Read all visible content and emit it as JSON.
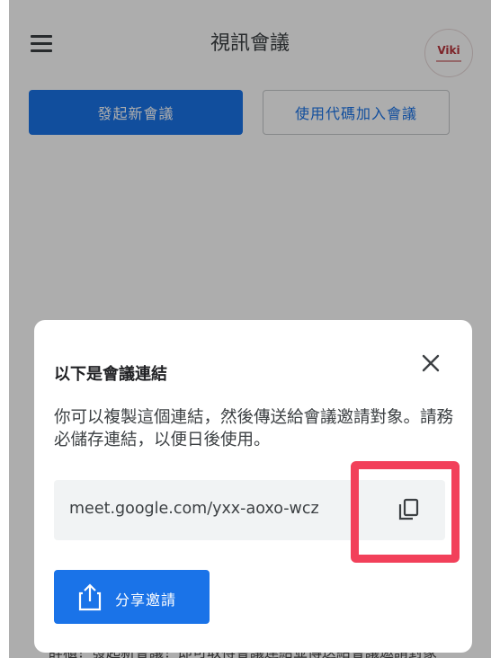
{
  "appbar": {
    "title": "視訊會議",
    "menu_icon": "hamburger-menu-icon",
    "avatar_text": "Viki"
  },
  "actions": {
    "new_meeting": "發起新會議",
    "join_with_code": "使用代碼加入會議"
  },
  "background_text": "辞櫃！發起新會議！即可取得會議連結並傳送給會議邀請對象",
  "dialog": {
    "title": "以下是會議連結",
    "body": "你可以複製這個連結，然後傳送給會議邀請對象。請務必儲存連結，以便日後使用。",
    "link": "meet.google.com/yxx-aoxo-wcz",
    "copy_icon": "copy-icon",
    "close_icon": "close-icon",
    "share_label": "分享邀請",
    "share_icon": "share-icon"
  },
  "colors": {
    "primary": "#1a73e8",
    "highlight": "#f2405a",
    "link_box_bg": "#f1f3f4"
  }
}
